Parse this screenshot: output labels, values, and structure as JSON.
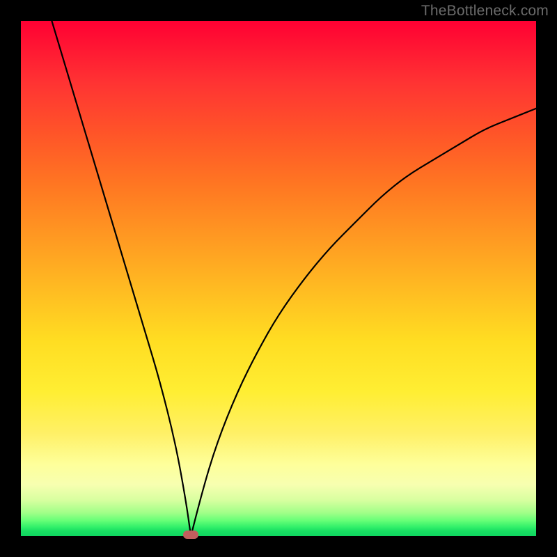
{
  "watermark": "TheBottleneck.com",
  "chart_data": {
    "type": "line",
    "title": "",
    "xlabel": "",
    "ylabel": "",
    "xlim": [
      0,
      100
    ],
    "ylim": [
      0,
      100
    ],
    "grid": false,
    "marker": {
      "x": 33,
      "y": 0,
      "color": "#c15e5e"
    },
    "gradient_stops": [
      {
        "pct": 0,
        "color": "#ff0033"
      },
      {
        "pct": 50,
        "color": "#ffcc22"
      },
      {
        "pct": 88,
        "color": "#feff9a"
      },
      {
        "pct": 100,
        "color": "#0fd660"
      }
    ],
    "series": [
      {
        "name": "left-branch",
        "x": [
          6,
          9,
          12,
          15,
          18,
          21,
          24,
          27,
          30,
          32,
          33
        ],
        "values": [
          100,
          90,
          80,
          70,
          60,
          50,
          40,
          30,
          18,
          7,
          0
        ]
      },
      {
        "name": "right-branch",
        "x": [
          33,
          35,
          38,
          42,
          46,
          50,
          55,
          60,
          65,
          70,
          75,
          80,
          85,
          90,
          95,
          100
        ],
        "values": [
          0,
          8,
          18,
          28,
          36,
          43,
          50,
          56,
          61,
          66,
          70,
          73,
          76,
          79,
          81,
          83
        ]
      }
    ]
  }
}
